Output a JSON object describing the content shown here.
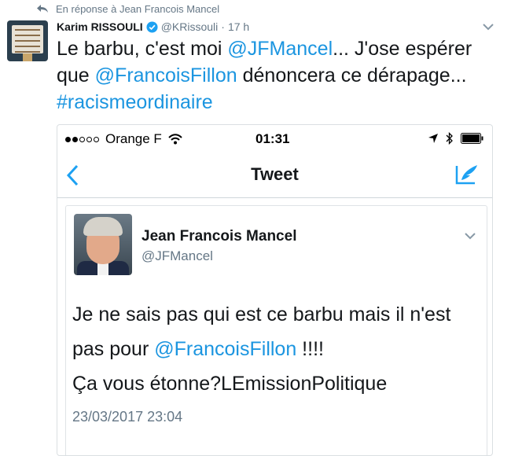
{
  "reply": {
    "label": "En réponse à Jean Francois Mancel"
  },
  "tweet": {
    "author_name": "Karim RISSOULI",
    "author_handle": "@KRissouli",
    "separator": "·",
    "time": "17 h",
    "text": {
      "p1": "Le barbu, c'est moi ",
      "mention1": "@JFMancel",
      "p2": "... J'ose espérer que ",
      "mention2": "@FrancoisFillon",
      "p3": " dénoncera ce dérapage... ",
      "hashtag": "#racismeordinaire"
    }
  },
  "screenshot": {
    "status": {
      "carrier": "Orange F",
      "clock": "01:31"
    },
    "nav": {
      "title": "Tweet"
    },
    "quoted": {
      "name": "Jean Francois Mancel",
      "handle": "@JFMancel",
      "text": {
        "p1": "Je ne sais pas qui est ce barbu mais il n'est pas pour ",
        "mention": "@FrancoisFillon",
        "p2": " !!!!",
        "p3": "Ça vous étonne?LEmissionPolitique"
      },
      "date": "23/03/2017 23:04"
    }
  },
  "colors": {
    "link": "#1b95e0",
    "muted": "#657786",
    "text": "#14171a"
  },
  "icons": [
    "reply-arrow-icon",
    "verified-badge-icon",
    "chevron-down-icon",
    "wifi-icon",
    "location-arrow-icon",
    "bluetooth-icon",
    "battery-icon",
    "back-chevron-icon",
    "compose-icon"
  ]
}
